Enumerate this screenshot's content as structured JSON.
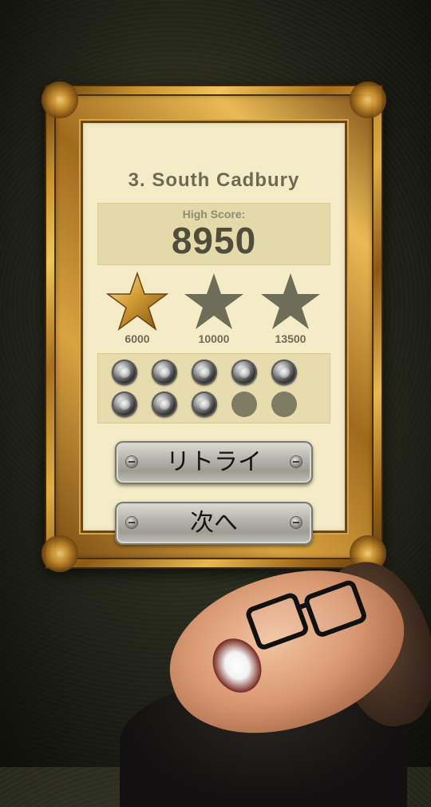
{
  "level": {
    "title": "3. South Cadbury"
  },
  "score": {
    "label": "High Score:",
    "value": "8950"
  },
  "stars": [
    {
      "threshold": "6000",
      "earned": true
    },
    {
      "threshold": "10000",
      "earned": false
    },
    {
      "threshold": "13500",
      "earned": false
    }
  ],
  "coins": {
    "collected": 8,
    "total": 10
  },
  "buttons": {
    "retry_label": "リトライ",
    "next_label": "次へ"
  },
  "colors": {
    "mat": "#f3ecc7",
    "title_text": "#6b6a52",
    "score_text": "#4f4d3b",
    "star_gold": "#c8922a",
    "star_gray": "#6e6d57",
    "coin_empty": "#7e7c63"
  }
}
